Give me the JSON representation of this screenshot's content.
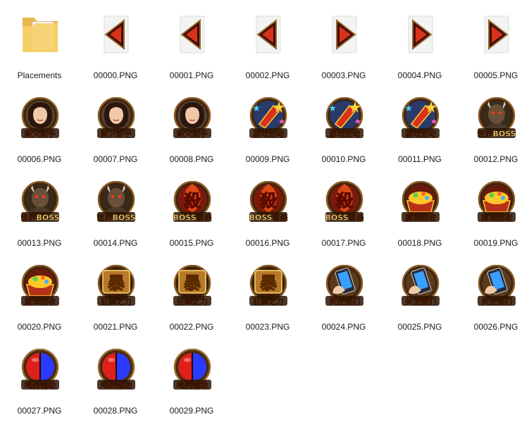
{
  "window": {
    "view": "large-icons"
  },
  "items": [
    {
      "name": "Placements",
      "icon": "folder-icon"
    },
    {
      "name": "00000.PNG",
      "icon": "arrow-left-icon",
      "badge": ""
    },
    {
      "name": "00001.PNG",
      "icon": "arrow-left-icon",
      "badge": ""
    },
    {
      "name": "00002.PNG",
      "icon": "arrow-left-icon",
      "badge": ""
    },
    {
      "name": "00003.PNG",
      "icon": "arrow-right-icon",
      "badge": ""
    },
    {
      "name": "00004.PNG",
      "icon": "arrow-right-icon",
      "badge": ""
    },
    {
      "name": "00005.PNG",
      "icon": "arrow-right-icon",
      "badge": ""
    },
    {
      "name": "00006.PNG",
      "icon": "newbie-helper-icon",
      "badge": "新人助手"
    },
    {
      "name": "00007.PNG",
      "icon": "newbie-helper-icon",
      "badge": "新人助手"
    },
    {
      "name": "00008.PNG",
      "icon": "newbie-helper-icon",
      "badge": "新人助手"
    },
    {
      "name": "00009.PNG",
      "icon": "game-activity-icon",
      "badge": "游戏活动"
    },
    {
      "name": "00010.PNG",
      "icon": "game-activity-icon",
      "badge": "游戏活动"
    },
    {
      "name": "00011.PNG",
      "icon": "game-activity-icon",
      "badge": "游戏活动"
    },
    {
      "name": "00012.PNG",
      "icon": "world-boss-icon",
      "badge": "世界BOSS"
    },
    {
      "name": "00013.PNG",
      "icon": "world-boss-icon",
      "badge": "世界BOSS"
    },
    {
      "name": "00014.PNG",
      "icon": "world-boss-icon",
      "badge": "世界BOSS"
    },
    {
      "name": "00015.PNG",
      "icon": "boss-first-kill-icon",
      "badge": "BOSS首杀"
    },
    {
      "name": "00016.PNG",
      "icon": "boss-first-kill-icon",
      "badge": "BOSS首杀"
    },
    {
      "name": "00017.PNG",
      "icon": "boss-first-kill-icon",
      "badge": "BOSS首杀"
    },
    {
      "name": "00018.PNG",
      "icon": "recycle-treasure-icon",
      "badge": "提现回收"
    },
    {
      "name": "00019.PNG",
      "icon": "recycle-treasure-icon",
      "badge": "提现回收"
    },
    {
      "name": "00020.PNG",
      "icon": "recycle-treasure-icon",
      "badge": "提现回收"
    },
    {
      "name": "00021.PNG",
      "icon": "berserk-power-icon",
      "badge": "狂暴之力"
    },
    {
      "name": "00022.PNG",
      "icon": "berserk-power-icon",
      "badge": "狂暴之力"
    },
    {
      "name": "00023.PNG",
      "icon": "berserk-power-icon",
      "badge": "狂暴之力"
    },
    {
      "name": "00024.PNG",
      "icon": "follow-us-phone-icon",
      "badge": "关注我们"
    },
    {
      "name": "00025.PNG",
      "icon": "follow-us-phone-icon",
      "badge": "关注我们"
    },
    {
      "name": "00026.PNG",
      "icon": "follow-us-phone-icon",
      "badge": "关注我们"
    },
    {
      "name": "00027.PNG",
      "icon": "potion-assist-icon",
      "badge": "喝药辅助"
    },
    {
      "name": "00028.PNG",
      "icon": "potion-assist-icon",
      "badge": "喝药辅助"
    },
    {
      "name": "00029.PNG",
      "icon": "potion-assist-icon",
      "badge": "喝药辅助"
    }
  ],
  "big_chars": {
    "kill": "殺",
    "rage": "暴"
  }
}
